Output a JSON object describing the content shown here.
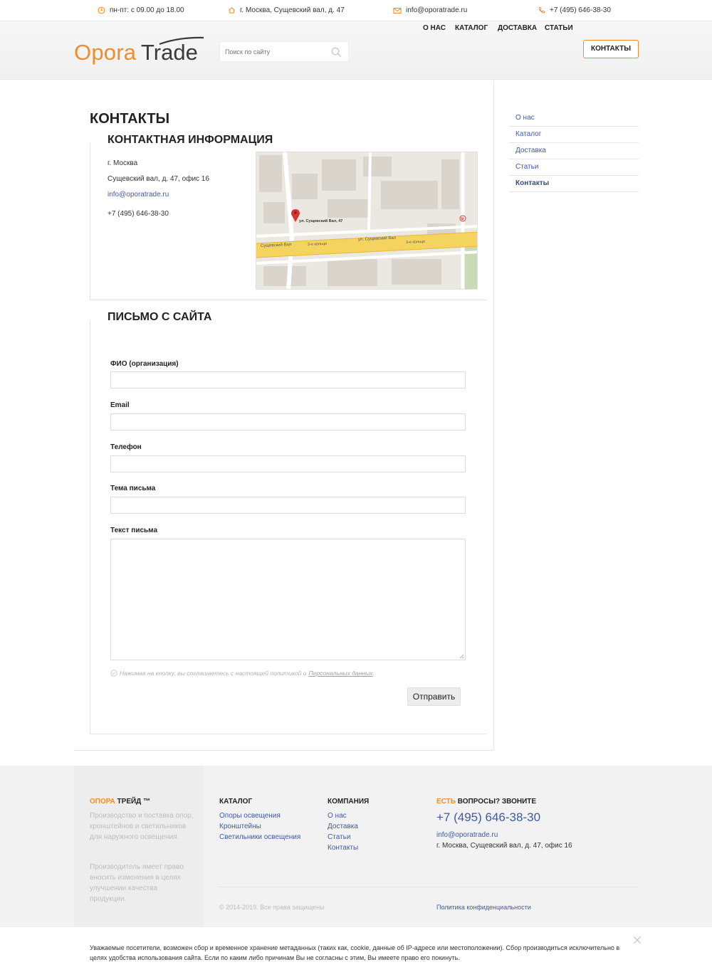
{
  "topbar": {
    "hours": "пн-пт: с 09.00 до 18.00",
    "address": "г. Москва, Сущевский вал, д. 47",
    "email": "info@oporatrade.ru",
    "phone": "+7 (495) 646-38-30"
  },
  "header": {
    "logo_part1": "Opora",
    "logo_part2": "Trade",
    "search_placeholder": "Поиск по сайту",
    "nav": {
      "about": "О НАС",
      "catalog": "КАТАЛОГ",
      "delivery": "ДОСТАВКА",
      "articles": "СТАТЬИ",
      "contacts": "КОНТАКТЫ"
    }
  },
  "main": {
    "title": "КОНТАКТЫ",
    "contact_info": {
      "title": "КОНТАКТНАЯ ИНФОРМАЦИЯ",
      "city": "г. Москва",
      "address": "Сущевский вал, д. 47, офис 16",
      "email": "info@oporatrade.ru",
      "phone": "+7 (495) 646-38-30"
    },
    "map": {
      "marker_label": "ул. Сущевский Вал, 47",
      "street1": "Сущевский Вал",
      "street2": "ул. Сущевский Вал",
      "ring1": "3-е кольцо",
      "ring2": "3-е кольцо"
    },
    "form": {
      "title": "ПИСЬМО С САЙТА",
      "fields": {
        "name_label": "ФИО (организация)",
        "email_label": "Email",
        "phone_label": "Телефон",
        "subject_label": "Тема письма",
        "message_label": "Текст письма"
      },
      "consent_text": "Нажимая на кнопку, вы соглашаетесь с настоящей политикой о",
      "consent_link": "Персональных данных",
      "consent_end": ".",
      "submit_label": "Отправить"
    }
  },
  "sidebar": {
    "items": [
      {
        "label": "О нас"
      },
      {
        "label": "Каталог"
      },
      {
        "label": "Доставка"
      },
      {
        "label": "Статьи"
      },
      {
        "label": "Контакты"
      }
    ]
  },
  "footer": {
    "brand_title_orange": "ОПОРА",
    "brand_title_rest": " ТРЕЙД ™",
    "brand_text1": "Производство и поставка опор, кронштейнов и светильников для наружного освещения.",
    "brand_text2": "Производитель имеет право вносить изменения в целях улучшении качества продукции.",
    "catalog_title": "КАТАЛОГ",
    "catalog_links": [
      "Опоры освещения",
      "Кронштейны",
      "Светильники освещения"
    ],
    "company_title": "КОМПАНИЯ",
    "company_links": [
      "О нас",
      "Доставка",
      "Статьи",
      "Контакты"
    ],
    "questions_title_orange": "ЕСТЬ",
    "questions_title_rest": " ВОПРОСЫ? ЗВОНИТЕ",
    "phone": "+7 (495) 646-38-30",
    "email": "info@oporatrade.ru",
    "address": "г. Москва, Сущевский вал, д. 47, офис 16",
    "copyright": "© 2014-2019. Все права защищены",
    "privacy": "Политика конфиденциальности"
  },
  "cookie": {
    "text": "Уважаемые посетители, возможен сбор и временное хранение метаданных (таких как, cookie, данные об IP-адресе или местоположении). Сбор производиться исключительно в целях удобства использования сайта. Если по каким либо причинам Вы не согласны с этим, Вы имеете право его покинуть."
  },
  "colors": {
    "accent": "#f08c2a",
    "link": "#3d5aa8"
  }
}
